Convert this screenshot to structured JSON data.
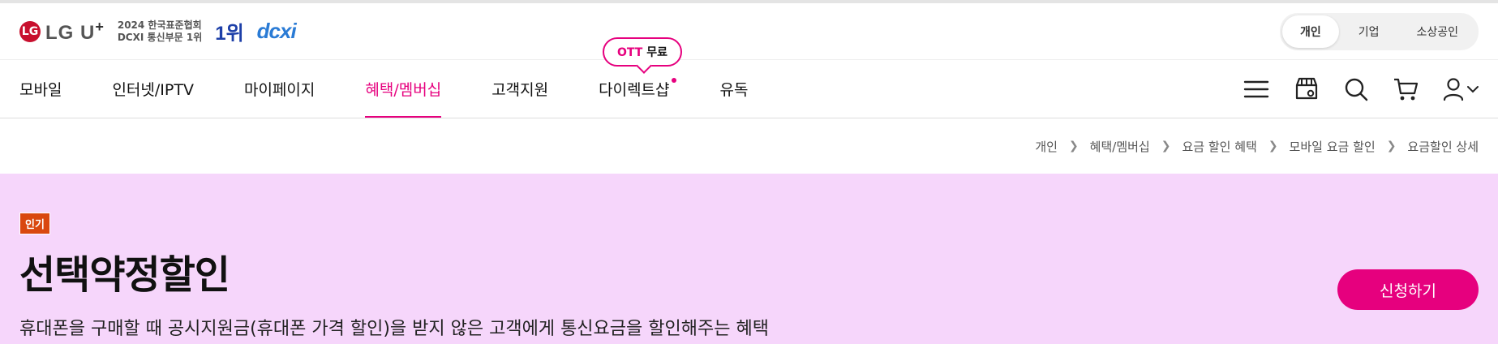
{
  "brand": {
    "logo_mark": "LG",
    "logo_text": "LG U",
    "logo_plus": "+",
    "award_line1": "2024 한국표준협회",
    "award_line2": "DCXI 통신부문 1위",
    "rank_text": "1위",
    "dcx_text": "dcxi"
  },
  "segments": [
    {
      "label": "개인",
      "active": true
    },
    {
      "label": "기업",
      "active": false
    },
    {
      "label": "소상공인",
      "active": false
    }
  ],
  "nav": {
    "items": [
      "모바일",
      "인터넷/IPTV",
      "마이페이지",
      "혜택/멤버십",
      "고객지원",
      "다이렉트샵",
      "유독"
    ],
    "active_index": 3,
    "bubble_pink": "OTT",
    "bubble_text": " 무료"
  },
  "icons": [
    "menu-icon",
    "store-location-icon",
    "search-icon",
    "cart-icon",
    "user-icon",
    "chevron-down-icon"
  ],
  "breadcrumb": [
    "개인",
    "혜택/멤버십",
    "요금 할인 혜택",
    "모바일 요금 할인",
    "요금할인 상세"
  ],
  "hero": {
    "badge": "인기",
    "title": "선택약정할인",
    "description": "휴대폰을 구매할 때 공시지원금(휴대폰 가격 할인)을 받지 않은 고객에게 통신요금을 할인해주는 혜택",
    "apply_label": "신청하기"
  },
  "colors": {
    "accent": "#e6007e",
    "hero_bg": "#f6d6fb",
    "badge_bg": "#d9480f",
    "logo_red": "#c8102e"
  }
}
